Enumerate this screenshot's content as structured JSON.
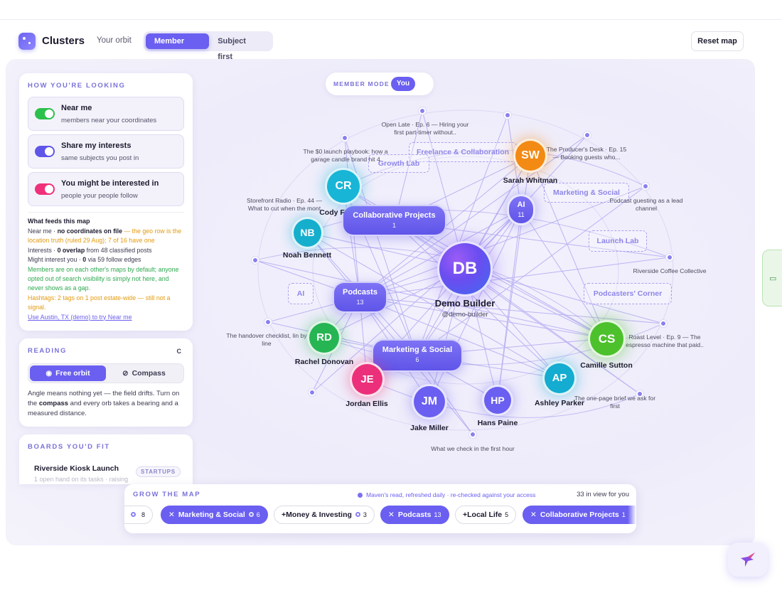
{
  "header": {
    "title": "Clusters",
    "orbit_link": "Your orbit",
    "tabs": [
      "Member first",
      "Subject first"
    ],
    "reset": "Reset map"
  },
  "looking": {
    "title": "HOW YOU'RE LOOKING",
    "toggles": [
      {
        "title": "Near me",
        "sub": "members near your coordinates",
        "color": "#2bc04c"
      },
      {
        "title": "Share my interests",
        "sub": "same subjects you post in",
        "color": "#5f55e8"
      },
      {
        "title": "You might be interested in",
        "sub": "people your people follow",
        "color": "#f0307a"
      }
    ],
    "feed_title": "What feeds this map",
    "feed": {
      "near_a": "Near me · ",
      "near_b": "no coordinates on file",
      "near_c": " — the geo row is the location truth (ruled 29 Aug); 7 of 16 have one",
      "int_a": "Interests · ",
      "int_b": "0 overlap",
      "int_c": " from 48 classified posts",
      "might_a": "Might interest you · ",
      "might_b": "0",
      "might_c": " via 59 follow edges",
      "members": "Members are on each other's maps by default; anyone opted out of search visibility is simply not here, and never shows as a gap.",
      "hashtags": "Hashtags: 2 tags on 1 post estate-wide — still not a signal.",
      "link": "Use Austin, TX (demo) to try Near me"
    }
  },
  "reading": {
    "title": "READING",
    "c": "C",
    "tabs": [
      "Free orbit",
      "Compass"
    ],
    "note_a": "Angle means nothing yet — the field drifts. Turn on the ",
    "note_b": "compass",
    "note_c": " and every orb takes a bearing and a measured distance."
  },
  "boards": {
    "title": "BOARDS YOU'D FIT",
    "name": "Riverside Kiosk Launch",
    "tag": "STARTUPS",
    "sub": "1 open hand on its tasks · raising"
  },
  "member_mode": {
    "label": "MEMBER MODE",
    "you": "You"
  },
  "center": {
    "initials": "DB",
    "name": "Demo Builder",
    "handle": "@demo-builder"
  },
  "members": [
    {
      "initials": "SW",
      "name": "Sarah Whitman",
      "color": "#f28a14"
    },
    {
      "initials": "CR",
      "name": "Cody F",
      "color": "#18b5d6"
    },
    {
      "initials": "NB",
      "name": "Noah Bennett",
      "color": "#16aecd"
    },
    {
      "initials": "AI",
      "name": "",
      "color": "#6a5ff0"
    },
    {
      "initials": "RD",
      "name": "Rachel Donovan",
      "color": "#26b553"
    },
    {
      "initials": "JE",
      "name": "Jordan Ellis",
      "color": "#ec2f7a"
    },
    {
      "initials": "JM",
      "name": "Jake Miller",
      "color": "#6a5ff0"
    },
    {
      "initials": "HP",
      "name": "Hans Paine",
      "color": "#6a5ff0"
    },
    {
      "initials": "AP",
      "name": "Ashley Parker",
      "color": "#14acd0"
    },
    {
      "initials": "CS",
      "name": "Camille Sutton",
      "color": "#4cc12c"
    }
  ],
  "ai_count": "11",
  "subjects": [
    {
      "title": "Collaborative Projects",
      "count": "1"
    },
    {
      "title": "Podcasts",
      "count": "13"
    },
    {
      "title": "Marketing & Social",
      "count": "6"
    }
  ],
  "ghosts": [
    "Freelance & Collaboration",
    "Growth Lab",
    "Marketing & Social",
    "Launch Lab",
    "AI",
    "Podcasters' Corner"
  ],
  "posts": [
    {
      "text": "Open Late · Ep. 6 — Hiring your first part-timer without.."
    },
    {
      "text": "The $0 launch playbook: how a garage candle brand hit 4"
    },
    {
      "text": "The Producer's Desk · Ep. 15 — Booking guests who..."
    },
    {
      "text": "Storefront Radio · Ep. 44 — What to cut when the mont"
    },
    {
      "text": "Podcast guesting as a lead channel"
    },
    {
      "text": "Riverside Coffee Collective"
    },
    {
      "text": "The handover checklist, lin by line"
    },
    {
      "text": "Roast Level · Ep. 9 — The espresso machine that paid.."
    },
    {
      "text": "The one-page brief we ask for first"
    },
    {
      "text": "What we check in the first hour"
    }
  ],
  "grow": {
    "title": "GROW THE MAP",
    "status": "Maven's read, refreshed daily · re-checked against your access",
    "count": "33 in view for you",
    "chips": [
      {
        "label": "",
        "count": "8"
      },
      {
        "label": "Marketing & Social",
        "count": "6"
      },
      {
        "label": "+Money & Investing",
        "count": "3"
      },
      {
        "label": "Podcasts",
        "count": "13"
      },
      {
        "label": "+Local Life",
        "count": "5"
      },
      {
        "label": "Collaborative Projects",
        "count": "1"
      }
    ]
  },
  "colors": {
    "accent": "#6a5ff0",
    "near": "#2bc04c",
    "warn": "#e39a10"
  }
}
